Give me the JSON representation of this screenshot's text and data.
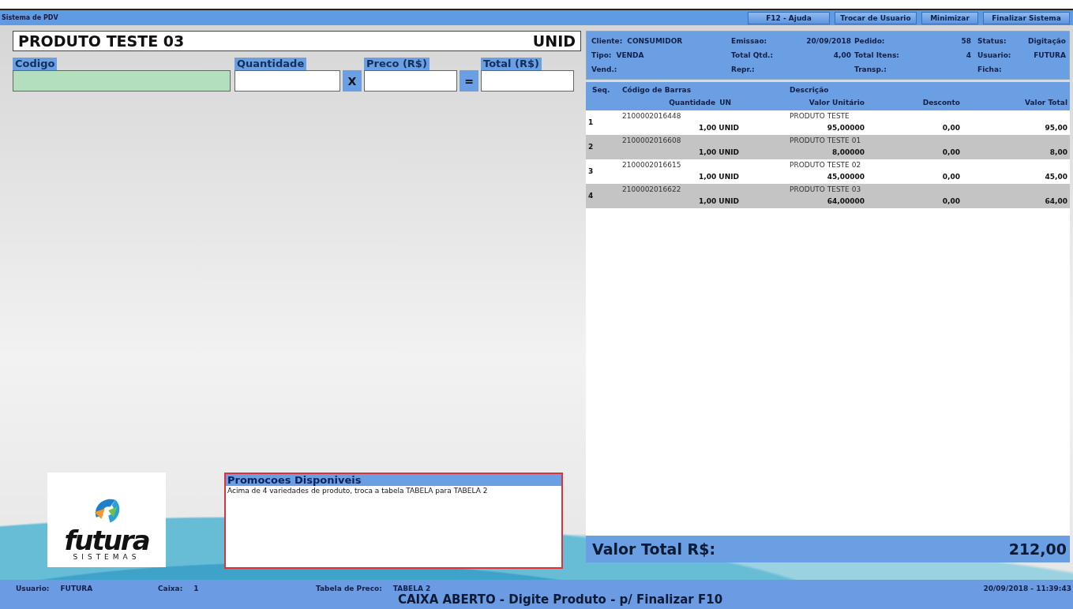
{
  "window": {
    "title": "Sistema de PDV"
  },
  "top_buttons": [
    "F12 - Ajuda",
    "Trocar de Usuario",
    "Minimizar",
    "Finalizar Sistema"
  ],
  "product": {
    "name": "PRODUTO TESTE 03",
    "unit": "UNID"
  },
  "entry": {
    "fields": [
      {
        "label": "Codigo",
        "focused": true
      },
      {
        "label": "Quantidade",
        "focused": false
      },
      {
        "label": "Preco (R$)",
        "focused": false
      },
      {
        "label": "Total (R$)",
        "focused": false
      }
    ],
    "operators": [
      "X",
      "="
    ]
  },
  "info": [
    [
      {
        "label": "Cliente:",
        "value": "CONSUMIDOR"
      },
      {
        "label": "Emissao:",
        "value": "20/09/2018"
      },
      {
        "label": "Pedido:",
        "value": "58"
      },
      {
        "label": "Status:",
        "value": "Digitação"
      }
    ],
    [
      {
        "label": "Tipo:",
        "value": "VENDA"
      },
      {
        "label": "Total Qtd.:",
        "value": "4,00"
      },
      {
        "label": "Total Itens:",
        "value": "4"
      },
      {
        "label": "Usuario:",
        "value": "FUTURA"
      }
    ],
    [
      {
        "label": "Vend.:"
      },
      {
        "label": "Repr.:"
      },
      {
        "label": "Transp.:"
      },
      {
        "label": "Ficha:"
      }
    ]
  ],
  "table": {
    "columns": {
      "seq": "Seq.",
      "barcode": "Código de Barras",
      "description": "Descrição",
      "quantity": "Quantidade",
      "unit": "UN",
      "unit_price": "Valor Unitário",
      "discount": "Desconto",
      "total": "Valor Total"
    },
    "rows": [
      {
        "seq": "1",
        "barcode": "2100002016448",
        "description": "PRODUTO TESTE",
        "quantity": "1,00 UNID",
        "unit_price": "95,00000",
        "discount": "0,00",
        "total": "95,00"
      },
      {
        "seq": "2",
        "barcode": "2100002016608",
        "description": "PRODUTO TESTE 01",
        "quantity": "1,00 UNID",
        "unit_price": "8,00000",
        "discount": "0,00",
        "total": "8,00"
      },
      {
        "seq": "3",
        "barcode": "2100002016615",
        "description": "PRODUTO TESTE 02",
        "quantity": "1,00 UNID",
        "unit_price": "45,00000",
        "discount": "0,00",
        "total": "45,00"
      },
      {
        "seq": "4",
        "barcode": "2100002016622",
        "description": "PRODUTO TESTE 03",
        "quantity": "1,00 UNID",
        "unit_price": "64,00000",
        "discount": "0,00",
        "total": "64,00"
      }
    ]
  },
  "total": {
    "label": "Valor Total R$:",
    "value": "212,00"
  },
  "logo": {
    "name": "futura",
    "tagline": "SISTEMAS"
  },
  "promotions": {
    "title": "Promocoes Disponiveis",
    "text": "Acima de 4 variedades de produto, troca a tabela TABELA para TABELA 2"
  },
  "status_bar": {
    "items": [
      {
        "label": "Usuario:",
        "value": "FUTURA"
      },
      {
        "label": "Caixa:",
        "value": "1"
      },
      {
        "label": "Tabela de Preco:",
        "value": "TABELA 2"
      }
    ],
    "datetime": "20/09/2018 - 11:39:43",
    "message": "CAIXA ABERTO - Digite Produto - p/ Finalizar F10"
  }
}
